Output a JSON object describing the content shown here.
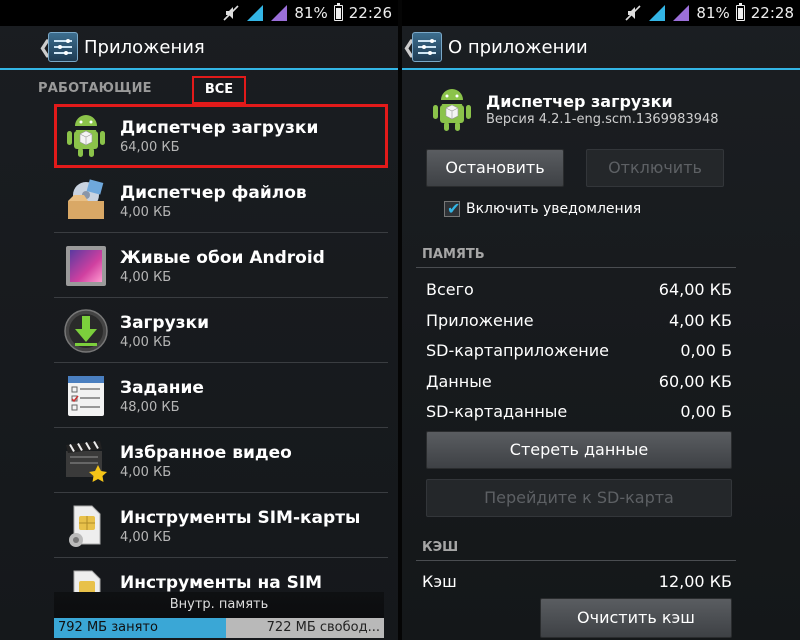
{
  "status_bar_left": {
    "battery_percent": "81%",
    "time": "22:26"
  },
  "status_bar_right": {
    "battery_percent": "81%",
    "time": "22:28"
  },
  "left": {
    "title": "Приложения",
    "tabs": [
      "РАБОТАЮЩИЕ",
      "ВСЕ"
    ],
    "apps": [
      {
        "name": "Диспетчер загрузки",
        "size": "64,00 КБ",
        "icon": "android-box-icon"
      },
      {
        "name": "Диспетчер файлов",
        "size": "4,00 КБ",
        "icon": "file-manager-icon"
      },
      {
        "name": "Живые обои Android",
        "size": "4,00 КБ",
        "icon": "live-wallpaper-icon"
      },
      {
        "name": "Загрузки",
        "size": "4,00 КБ",
        "icon": "download-icon"
      },
      {
        "name": "Задание",
        "size": "48,00 КБ",
        "icon": "task-list-icon"
      },
      {
        "name": "Избранное видео",
        "size": "4,00 КБ",
        "icon": "favorite-video-icon"
      },
      {
        "name": "Инструменты SIM-карты",
        "size": "4,00 КБ",
        "icon": "sim-tools-icon"
      },
      {
        "name": "Инструменты на SIM",
        "size": "",
        "icon": "sim-tools-icon"
      }
    ],
    "storage": {
      "label": "Внутр. память",
      "used": "792 МБ занято",
      "free": "722 МБ свобод...",
      "used_fraction": 0.52
    }
  },
  "right": {
    "title": "О приложении",
    "app_name": "Диспетчер загрузки",
    "version": "Версия 4.2.1-eng.scm.1369983948",
    "btn_stop": "Остановить",
    "btn_disable": "Отключить",
    "notifications_label": "Включить уведомления",
    "notifications_checked": true,
    "memory_section": "ПАМЯТЬ",
    "memory": [
      {
        "label": "Всего",
        "value": "64,00 КБ"
      },
      {
        "label": "Приложение",
        "value": "4,00 КБ"
      },
      {
        "label": "SD-картаприложение",
        "value": "0,00 Б"
      },
      {
        "label": "Данные",
        "value": "60,00 КБ"
      },
      {
        "label": "SD-картаданные",
        "value": "0,00 Б"
      }
    ],
    "btn_clear_data": "Стереть данные",
    "btn_move_sd": "Перейдите к SD-карта",
    "cache_section": "КЭШ",
    "cache_label": "Кэш",
    "cache_value": "12,00 КБ",
    "btn_clear_cache": "Очистить кэш"
  },
  "colors": {
    "accent": "#33b5e5",
    "highlight": "#e21a1a"
  }
}
